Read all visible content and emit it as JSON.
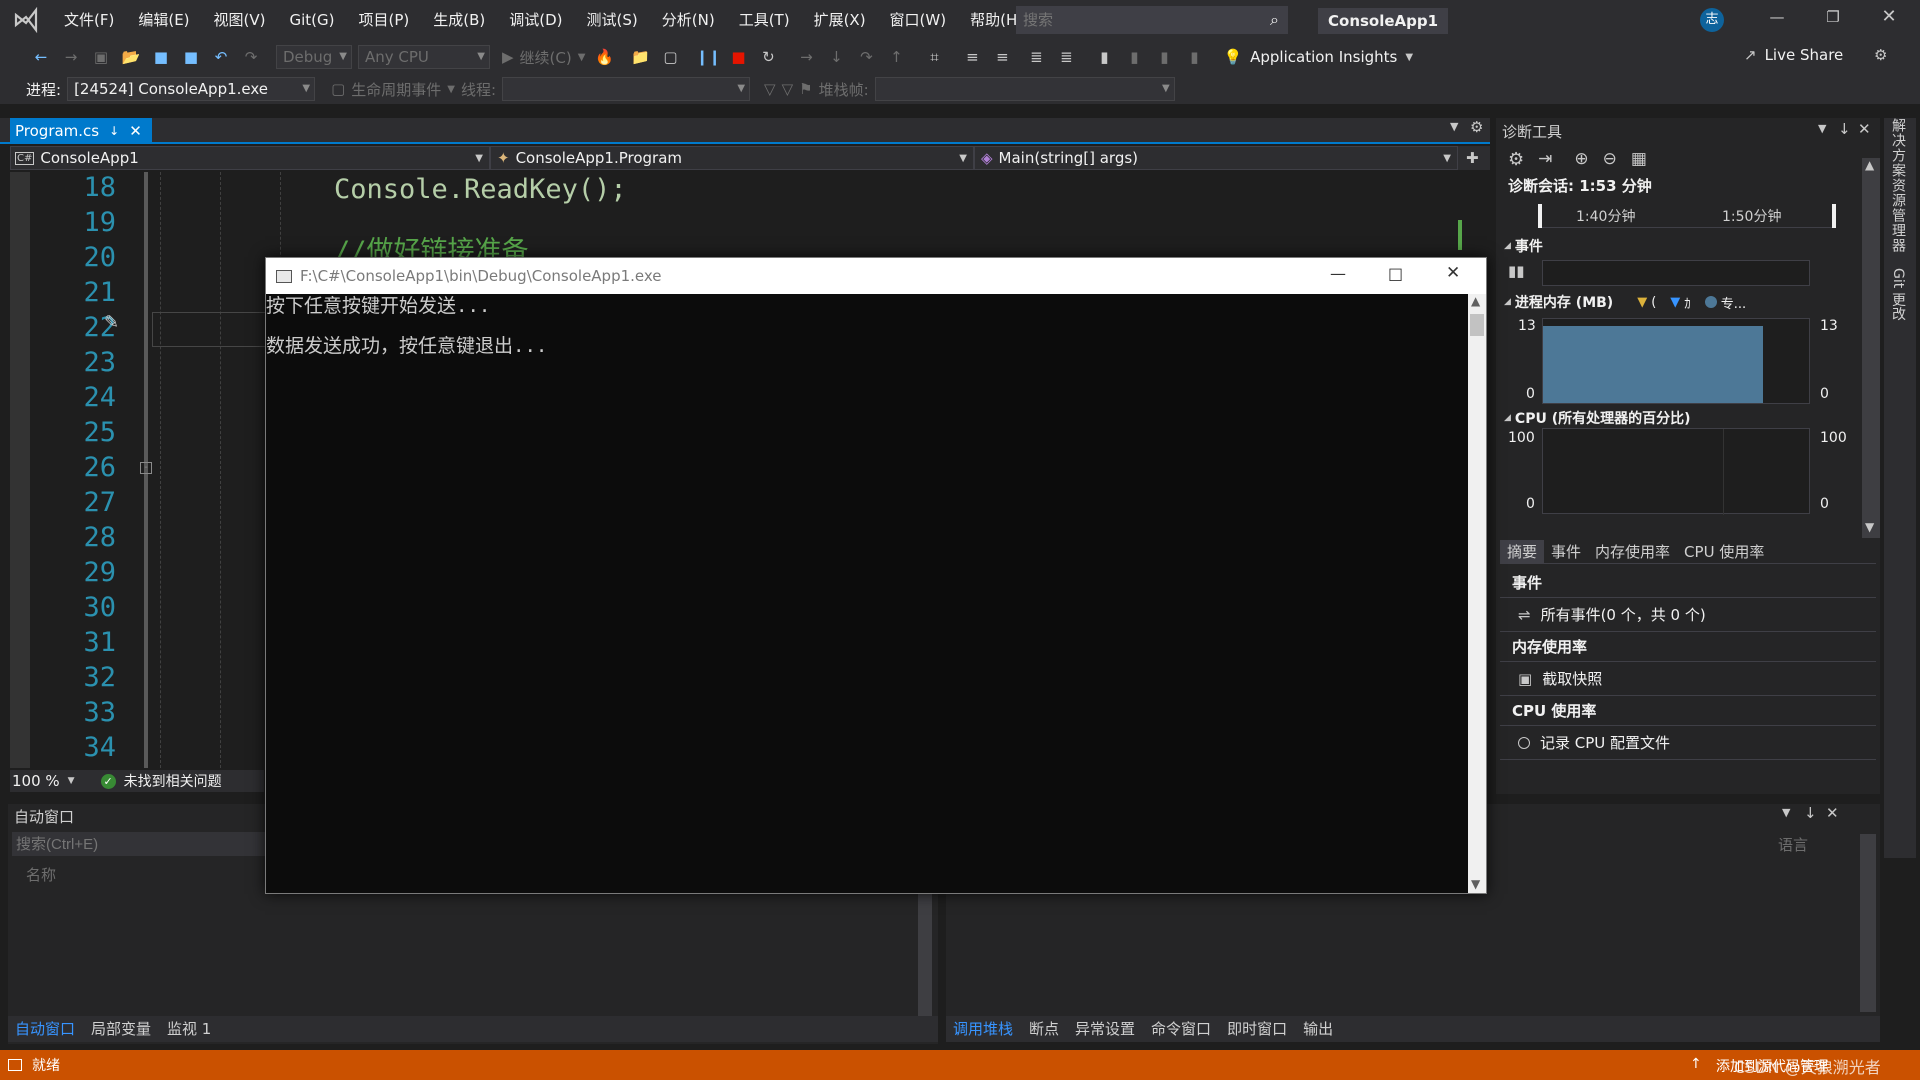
{
  "titlebar": {
    "menu": [
      "文件(F)",
      "编辑(E)",
      "视图(V)",
      "Git(G)",
      "项目(P)",
      "生成(B)",
      "调试(D)",
      "测试(S)",
      "分析(N)",
      "工具(T)",
      "扩展(X)",
      "窗口(W)",
      "帮助(H)"
    ],
    "search_placeholder": "搜索",
    "solution_name": "ConsoleApp1",
    "avatar_initial": "志"
  },
  "toolbar1": {
    "config": "Debug",
    "platform": "Any CPU",
    "continue_label": "继续(C)",
    "app_insights": "Application Insights",
    "live_share": "Live Share"
  },
  "toolbar2": {
    "process_label": "进程:",
    "process_value": "[24524] ConsoleApp1.exe",
    "lifecycle_label": "生命周期事件",
    "thread_label": "线程:",
    "stackframe_label": "堆栈帧:"
  },
  "editor": {
    "tab_name": "Program.cs",
    "nav_project": "ConsoleApp1",
    "nav_class": "ConsoleApp1.Program",
    "nav_member": "Main(string[] args)",
    "line_numbers": [
      "18",
      "19",
      "20",
      "21",
      "22",
      "23",
      "24",
      "25",
      "26",
      "27",
      "28",
      "29",
      "30",
      "31",
      "32",
      "33",
      "34"
    ],
    "code_line_18": "Console.ReadKey();",
    "code_line_19_comment": "//做好链接准备",
    "zoom": "100 %",
    "issues_text": "未找到相关问题"
  },
  "console": {
    "title": "F:\\C#\\ConsoleApp1\\bin\\Debug\\ConsoleApp1.exe",
    "lines": [
      "按下任意按键开始发送...",
      "数据发送成功，按任意键退出..."
    ]
  },
  "diag": {
    "title": "诊断工具",
    "session": "诊断会话: 1:53 分钟",
    "timeline_ticks": [
      "1:40分钟",
      "1:50分钟"
    ],
    "events_label": "事件",
    "memory_label": "进程内存 (MB)",
    "memory_legend": [
      "(",
      "ｶ",
      "专..."
    ],
    "memory_max": "13",
    "memory_min": "0",
    "cpu_label": "CPU (所有处理器的百分比)",
    "cpu_max": "100",
    "cpu_min": "0",
    "tabs": [
      "摘要",
      "事件",
      "内存使用率",
      "CPU 使用率"
    ],
    "sections": [
      {
        "head": "事件",
        "item": "所有事件(0 个，共 0 个)"
      },
      {
        "head": "内存使用率",
        "item": "截取快照"
      },
      {
        "head": "CPU 使用率",
        "item": "记录 CPU 配置文件"
      }
    ],
    "memory_fill_percent": 100
  },
  "side_tabs": [
    "解决方案资源管理器",
    "Git 更改"
  ],
  "auto_window": {
    "title": "自动窗口",
    "search_placeholder": "搜索(Ctrl+E)",
    "col_name": "名称",
    "tabs": [
      "自动窗口",
      "局部变量",
      "监视 1"
    ]
  },
  "callstack": {
    "col_lang": "语言",
    "tabs": [
      "调用堆栈",
      "断点",
      "异常设置",
      "命令窗口",
      "即时窗口",
      "输出"
    ]
  },
  "statusbar": {
    "state": "就绪",
    "right_text": "添加到源代码管理",
    "watermark": "CSDN @天狼溯光者"
  },
  "colors": {
    "status_bar": "#ca5100",
    "accent": "#007acc",
    "chart_fill": "#4d7897"
  }
}
